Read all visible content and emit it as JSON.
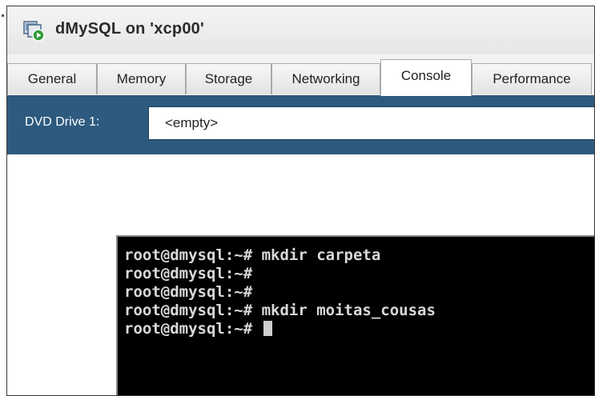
{
  "window": {
    "title": "dMySQL on 'xcp00'",
    "icon": "vm-running-icon"
  },
  "tabs": [
    {
      "label": "General"
    },
    {
      "label": "Memory"
    },
    {
      "label": "Storage"
    },
    {
      "label": "Networking"
    },
    {
      "label": "Console",
      "active": true
    },
    {
      "label": "Performance"
    }
  ],
  "dvd": {
    "label": "DVD Drive 1:",
    "value": "<empty>"
  },
  "terminal": {
    "lines": [
      "root@dmysql:~# mkdir carpeta",
      "root@dmysql:~#",
      "root@dmysql:~#",
      "root@dmysql:~# mkdir moitas_cousas",
      "root@dmysql:~# "
    ]
  },
  "colors": {
    "dvd_bar": "#2d5a7e",
    "terminal_bg": "#000000",
    "terminal_fg": "#d8d8d8"
  }
}
